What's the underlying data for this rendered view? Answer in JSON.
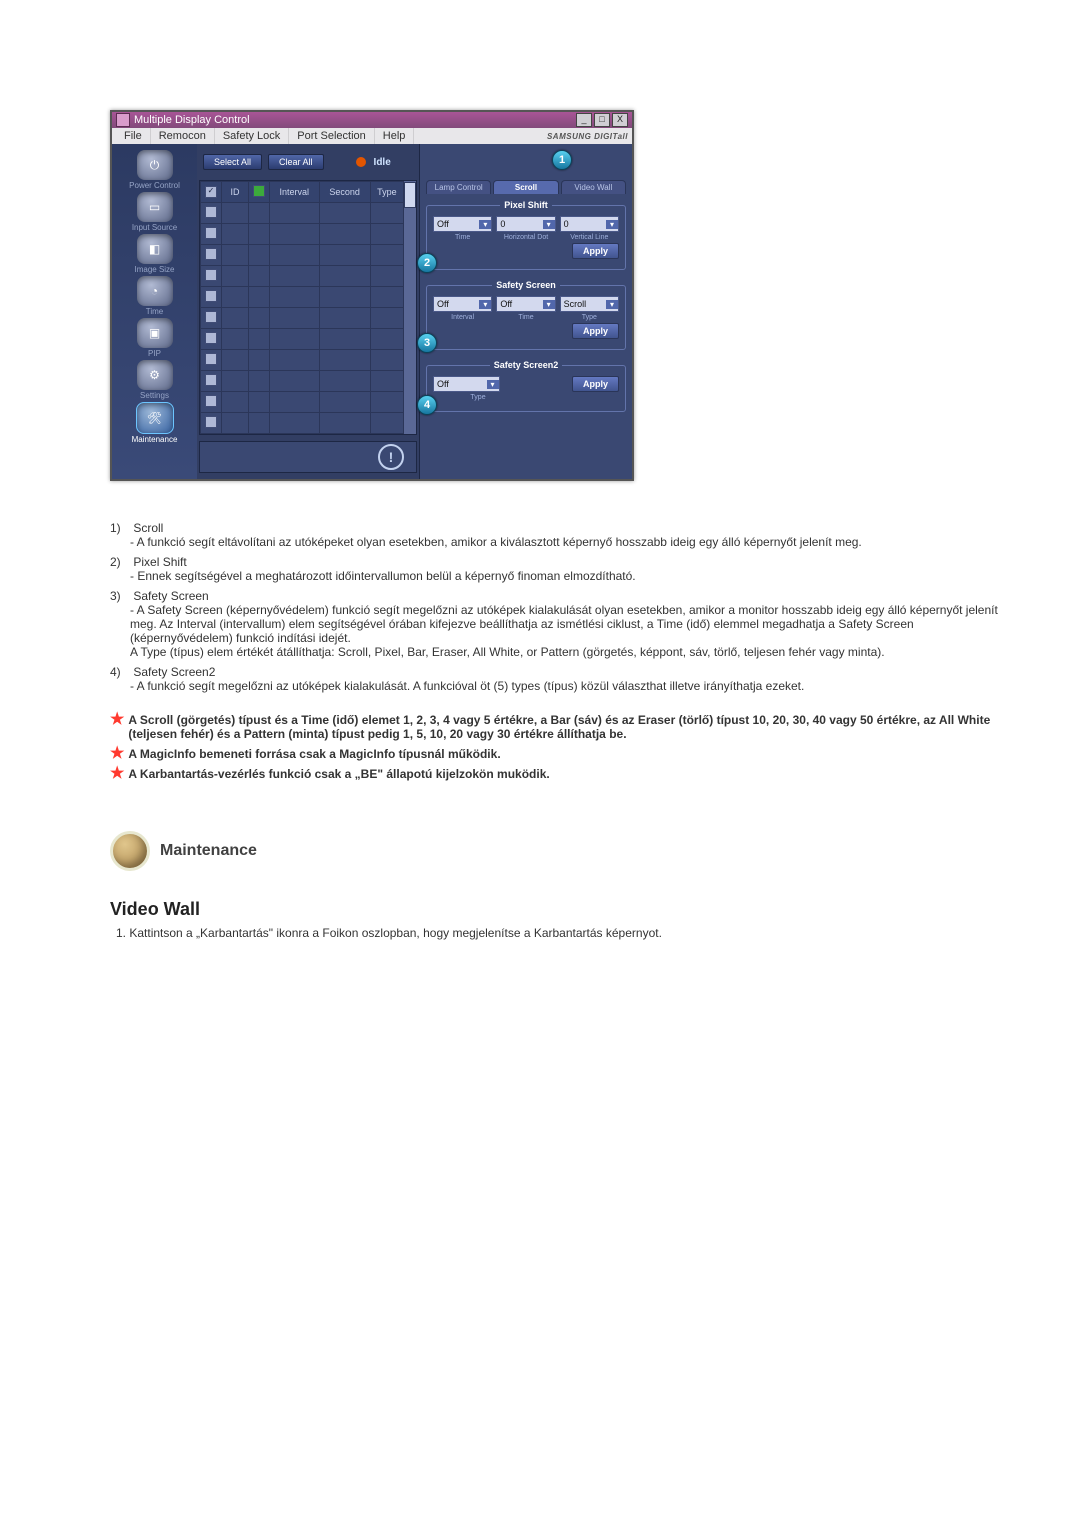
{
  "app": {
    "title": "Multiple Display Control",
    "menu": [
      "File",
      "Remocon",
      "Safety Lock",
      "Port Selection",
      "Help"
    ],
    "brand": "SAMSUNG DIGITall"
  },
  "sidebar": {
    "items": [
      {
        "label": "Power Control"
      },
      {
        "label": "Input Source"
      },
      {
        "label": "Image Size"
      },
      {
        "label": "Time"
      },
      {
        "label": "PIP"
      },
      {
        "label": "Settings"
      },
      {
        "label": "Maintenance"
      }
    ]
  },
  "toolbar": {
    "select_all": "Select All",
    "clear_all": "Clear All",
    "status": "Idle"
  },
  "grid": {
    "headers": [
      "",
      "ID",
      "",
      "Interval",
      "Second",
      "Type"
    ]
  },
  "right": {
    "tabs": [
      "Lamp Control",
      "Scroll",
      "Video Wall"
    ],
    "active_tab": 1,
    "pixel_shift": {
      "title": "Pixel Shift",
      "time": "Off",
      "hdot": "0",
      "vline": "0",
      "lbl_time": "Time",
      "lbl_hdot": "Horizontal Dot",
      "lbl_vline": "Vertical Line",
      "apply": "Apply"
    },
    "safety_screen": {
      "title": "Safety Screen",
      "interval": "Off",
      "time": "Off",
      "type": "Scroll",
      "lbl_interval": "Interval",
      "lbl_time": "Time",
      "lbl_type": "Type",
      "apply": "Apply"
    },
    "safety_screen2": {
      "title": "Safety Screen2",
      "type": "Off",
      "lbl_type": "Type",
      "apply": "Apply"
    }
  },
  "callouts": {
    "c1": "1",
    "c2": "2",
    "c3": "3",
    "c4": "4"
  },
  "doc": {
    "items": [
      {
        "num": "1)",
        "title": "Scroll",
        "sub": [
          "A funkció segít eltávolítani az utóképeket olyan esetekben, amikor a kiválasztott képernyő hosszabb ideig egy álló képernyőt jelenít meg."
        ]
      },
      {
        "num": "2)",
        "title": "Pixel Shift",
        "sub": [
          "Ennek segítségével a meghatározott időintervallumon belül a képernyő finoman elmozdítható."
        ]
      },
      {
        "num": "3)",
        "title": "Safety Screen",
        "sub": [
          "A Safety Screen (képernyővédelem) funkció segít megelőzni az utóképek kialakulását olyan esetekben, amikor a monitor hosszabb ideig egy álló képernyőt jelenít meg.  Az Interval (intervallum) elem segítségével órában kifejezve beállíthatja az ismétlési ciklust, a Time (idő) elemmel megadhatja a Safety Screen (képernyővédelem) funkció indítási idejét.\nA Type (típus) elem értékét átállíthatja: Scroll, Pixel, Bar, Eraser, All White, or Pattern (görgetés, képpont, sáv, törlő, teljesen fehér vagy minta)."
        ]
      },
      {
        "num": "4)",
        "title": "Safety Screen2",
        "sub": [
          "A funkció segít megelőzni az utóképek kialakulását. A funkcióval öt (5) types (típus) közül választhat illetve irányíthatja ezeket."
        ]
      }
    ],
    "notes": [
      "A Scroll (görgetés) típust és a Time (idő) elemet 1, 2, 3, 4 vagy 5 értékre, a Bar (sáv) és az Eraser (törlő) típust 10, 20, 30, 40 vagy 50 értékre, az All White (teljesen fehér) és a Pattern (minta) típust pedig 1, 5, 10, 20 vagy 30 értékre állíthatja be.",
      "A MagicInfo bemeneti forrása csak a MagicInfo típusnál működik.",
      "A Karbantartás-vezérlés funkció csak a „BE\" állapotú kijelzokön muködik."
    ],
    "section_title": "Maintenance",
    "sub_heading": "Video Wall",
    "step1": "1.  Kattintson a „Karbantartás\" ikonra a Foikon oszlopban, hogy megjelenítse a Karbantartás képernyot."
  }
}
